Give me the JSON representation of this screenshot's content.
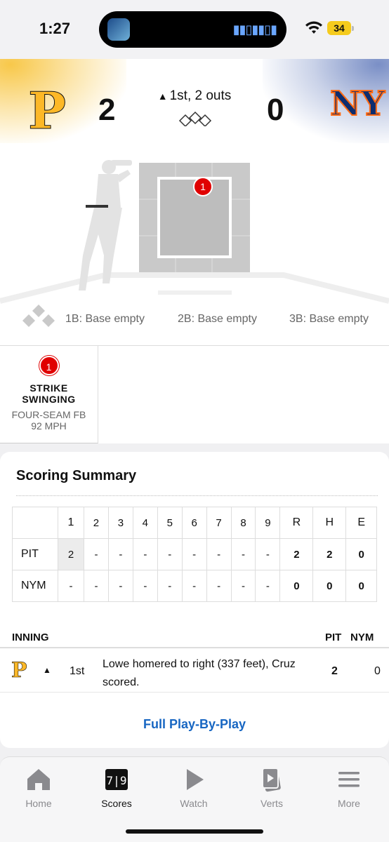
{
  "status_bar": {
    "time": "1:27",
    "battery": "34"
  },
  "game": {
    "away": {
      "abbr": "PIT",
      "score": "2"
    },
    "home": {
      "abbr": "NYM",
      "score": "0"
    },
    "inning_status": "1st, 2 outs"
  },
  "bases": {
    "first": "1B: Base empty",
    "second": "2B: Base empty",
    "third": "3B: Base empty"
  },
  "pitch": {
    "number": "1",
    "result_line1": "STRIKE",
    "result_line2": "SWINGING",
    "type": "FOUR-SEAM FB",
    "speed": "92 MPH"
  },
  "scoring_summary": {
    "title": "Scoring Summary",
    "linescore": {
      "headers": [
        "",
        "1",
        "2",
        "3",
        "4",
        "5",
        "6",
        "7",
        "8",
        "9",
        "R",
        "H",
        "E"
      ],
      "rows": [
        {
          "team": "PIT",
          "innings": [
            "2",
            "-",
            "-",
            "-",
            "-",
            "-",
            "-",
            "-",
            "-"
          ],
          "r": "2",
          "h": "2",
          "e": "0"
        },
        {
          "team": "NYM",
          "innings": [
            "-",
            "-",
            "-",
            "-",
            "-",
            "-",
            "-",
            "-",
            "-"
          ],
          "r": "0",
          "h": "0",
          "e": "0"
        }
      ]
    },
    "columns": {
      "inning": "INNING",
      "pit": "PIT",
      "nym": "NYM"
    },
    "plays": [
      {
        "inning": "1st",
        "description": "Lowe homered to right (337 feet), Cruz scored.",
        "pit": "2",
        "nym": "0"
      }
    ],
    "full_pbp": "Full Play-By-Play"
  },
  "tab_bar": {
    "items": [
      {
        "label": "Home",
        "icon": "home-icon"
      },
      {
        "label": "Scores",
        "icon": "scoreboard-icon",
        "active": true
      },
      {
        "label": "Watch",
        "icon": "play-icon"
      },
      {
        "label": "Verts",
        "icon": "verts-icon"
      },
      {
        "label": "More",
        "icon": "menu-icon"
      }
    ]
  },
  "colors": {
    "pirates_gold": "#fdb827",
    "mets_blue": "#0d2d6f",
    "mets_orange": "#ff6a13",
    "link_blue": "#1766c2",
    "pitch_red": "#e00000"
  }
}
